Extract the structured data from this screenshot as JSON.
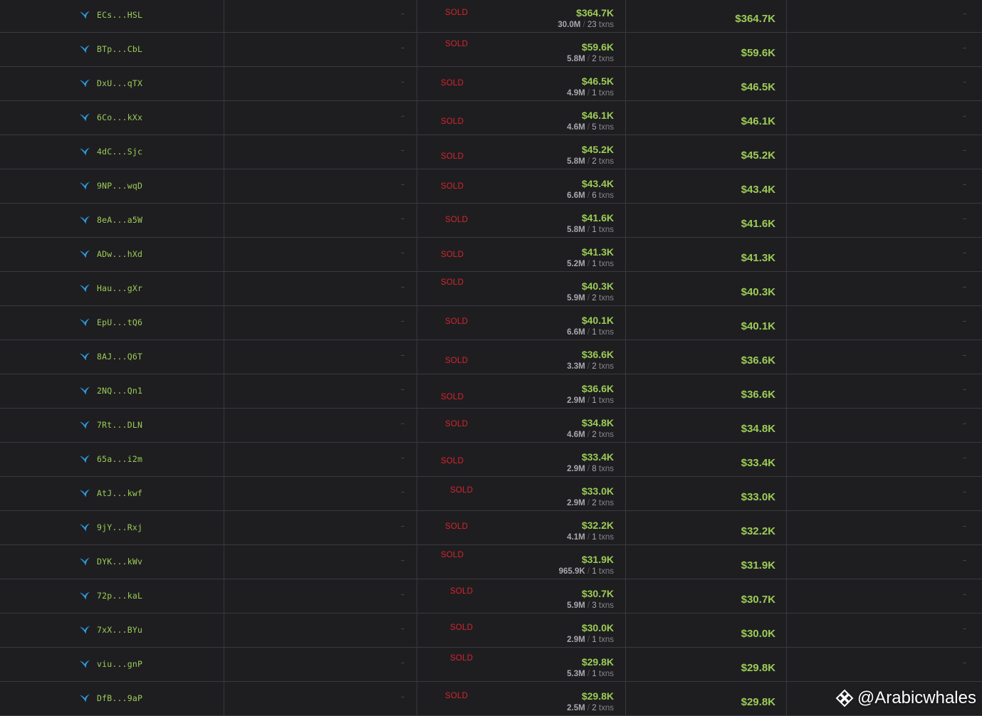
{
  "table": {
    "rows": [
      {
        "address": "ECs...HSL",
        "empty_left": "–",
        "status": "SOLD",
        "amount": "$364.7K",
        "tokens": "30.0M",
        "txns": "23",
        "txns_label": "txns",
        "pnl": "$364.7K",
        "empty_right": "–"
      },
      {
        "address": "BTp...CbL",
        "empty_left": "–",
        "status": "SOLD",
        "amount": "$59.6K",
        "tokens": "5.8M",
        "txns": "2",
        "txns_label": "txns",
        "pnl": "$59.6K",
        "empty_right": "–"
      },
      {
        "address": "DxU...qTX",
        "empty_left": "–",
        "status": "SOLD",
        "amount": "$46.5K",
        "tokens": "4.9M",
        "txns": "1",
        "txns_label": "txns",
        "pnl": "$46.5K",
        "empty_right": "–"
      },
      {
        "address": "6Co...kXx",
        "empty_left": "–",
        "status": "SOLD",
        "amount": "$46.1K",
        "tokens": "4.6M",
        "txns": "5",
        "txns_label": "txns",
        "pnl": "$46.1K",
        "empty_right": "–"
      },
      {
        "address": "4dC...Sjc",
        "empty_left": "–",
        "status": "SOLD",
        "amount": "$45.2K",
        "tokens": "5.8M",
        "txns": "2",
        "txns_label": "txns",
        "pnl": "$45.2K",
        "empty_right": "–"
      },
      {
        "address": "9NP...wqD",
        "empty_left": "–",
        "status": "SOLD",
        "amount": "$43.4K",
        "tokens": "6.6M",
        "txns": "6",
        "txns_label": "txns",
        "pnl": "$43.4K",
        "empty_right": "–"
      },
      {
        "address": "8eA...a5W",
        "empty_left": "–",
        "status": "SOLD",
        "amount": "$41.6K",
        "tokens": "5.8M",
        "txns": "1",
        "txns_label": "txns",
        "pnl": "$41.6K",
        "empty_right": "–"
      },
      {
        "address": "ADw...hXd",
        "empty_left": "–",
        "status": "SOLD",
        "amount": "$41.3K",
        "tokens": "5.2M",
        "txns": "1",
        "txns_label": "txns",
        "pnl": "$41.3K",
        "empty_right": "–"
      },
      {
        "address": "Hau...gXr",
        "empty_left": "–",
        "status": "SOLD",
        "amount": "$40.3K",
        "tokens": "5.9M",
        "txns": "2",
        "txns_label": "txns",
        "pnl": "$40.3K",
        "empty_right": "–"
      },
      {
        "address": "EpU...tQ6",
        "empty_left": "–",
        "status": "SOLD",
        "amount": "$40.1K",
        "tokens": "6.6M",
        "txns": "1",
        "txns_label": "txns",
        "pnl": "$40.1K",
        "empty_right": "–"
      },
      {
        "address": "8AJ...Q6T",
        "empty_left": "–",
        "status": "SOLD",
        "amount": "$36.6K",
        "tokens": "3.3M",
        "txns": "2",
        "txns_label": "txns",
        "pnl": "$36.6K",
        "empty_right": "–"
      },
      {
        "address": "2NQ...Qn1",
        "empty_left": "–",
        "status": "SOLD",
        "amount": "$36.6K",
        "tokens": "2.9M",
        "txns": "1",
        "txns_label": "txns",
        "pnl": "$36.6K",
        "empty_right": "–"
      },
      {
        "address": "7Rt...DLN",
        "empty_left": "–",
        "status": "SOLD",
        "amount": "$34.8K",
        "tokens": "4.6M",
        "txns": "2",
        "txns_label": "txns",
        "pnl": "$34.8K",
        "empty_right": "–"
      },
      {
        "address": "65a...i2m",
        "empty_left": "–",
        "status": "SOLD",
        "amount": "$33.4K",
        "tokens": "2.9M",
        "txns": "8",
        "txns_label": "txns",
        "pnl": "$33.4K",
        "empty_right": "–"
      },
      {
        "address": "AtJ...kwf",
        "empty_left": "–",
        "status": "SOLD",
        "amount": "$33.0K",
        "tokens": "2.9M",
        "txns": "2",
        "txns_label": "txns",
        "pnl": "$33.0K",
        "empty_right": "–"
      },
      {
        "address": "9jY...Rxj",
        "empty_left": "–",
        "status": "SOLD",
        "amount": "$32.2K",
        "tokens": "4.1M",
        "txns": "1",
        "txns_label": "txns",
        "pnl": "$32.2K",
        "empty_right": "–"
      },
      {
        "address": "DYK...kWv",
        "empty_left": "–",
        "status": "SOLD",
        "amount": "$31.9K",
        "tokens": "965.9K",
        "txns": "1",
        "txns_label": "txns",
        "pnl": "$31.9K",
        "empty_right": "–"
      },
      {
        "address": "72p...kaL",
        "empty_left": "–",
        "status": "SOLD",
        "amount": "$30.7K",
        "tokens": "5.9M",
        "txns": "3",
        "txns_label": "txns",
        "pnl": "$30.7K",
        "empty_right": "–"
      },
      {
        "address": "7xX...BYu",
        "empty_left": "–",
        "status": "SOLD",
        "amount": "$30.0K",
        "tokens": "2.9M",
        "txns": "1",
        "txns_label": "txns",
        "pnl": "$30.0K",
        "empty_right": "–"
      },
      {
        "address": "viu...gnP",
        "empty_left": "–",
        "status": "SOLD",
        "amount": "$29.8K",
        "tokens": "5.3M",
        "txns": "1",
        "txns_label": "txns",
        "pnl": "$29.8K",
        "empty_right": "–"
      },
      {
        "address": "DfB...9aP",
        "empty_left": "–",
        "status": "SOLD",
        "amount": "$29.8K",
        "tokens": "2.5M",
        "txns": "2",
        "txns_label": "txns",
        "pnl": "$29.8K",
        "empty_right": "–"
      }
    ]
  },
  "icons": {
    "wallet": "bird-icon",
    "watermark": "binance-square-icon"
  },
  "colors": {
    "background": "#1e1e21",
    "positive": "#9ccc55",
    "sold": "#d6242c",
    "bird": "#2b9de0",
    "muted": "#a8a8ae"
  },
  "watermark": {
    "handle": "@Arabicwhales"
  }
}
